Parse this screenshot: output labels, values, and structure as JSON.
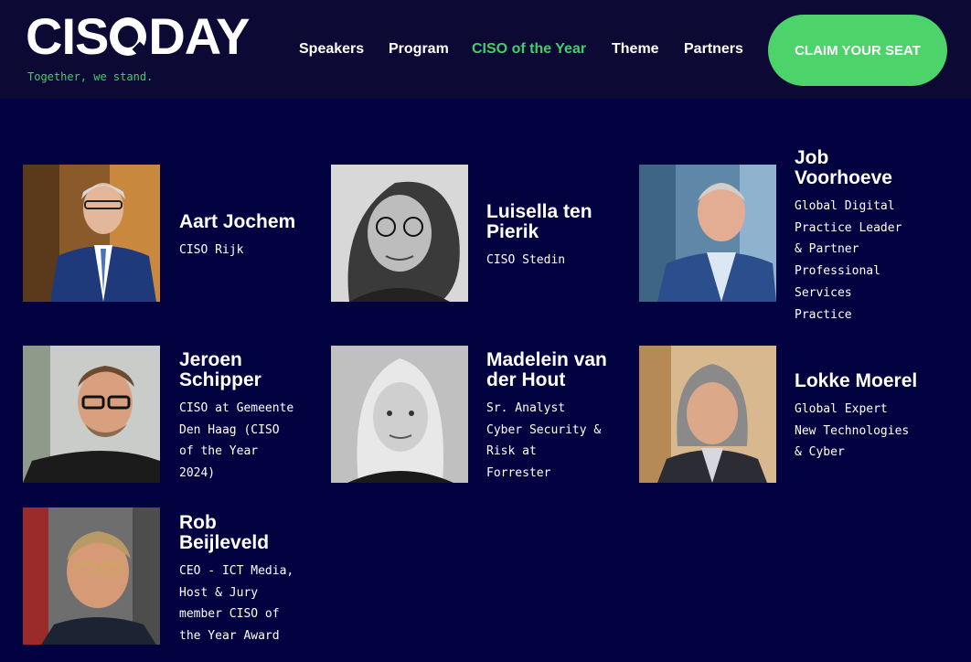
{
  "header": {
    "logo_text_a": "CIS",
    "logo_text_b": "DAY",
    "tagline": "Together, we stand.",
    "nav": [
      {
        "label": "Speakers"
      },
      {
        "label": "Program"
      },
      {
        "label": "CISO of the Year",
        "active": true
      },
      {
        "label": "Theme"
      },
      {
        "label": "Partners"
      }
    ],
    "cta_label": "CLAIM YOUR SEAT"
  },
  "colors": {
    "background": "#020240",
    "header_bg": "#0c0935",
    "accent": "#4cd36a"
  },
  "speakers": [
    {
      "name": "Aart Jochem",
      "role": "CISO Rijk"
    },
    {
      "name": "Luisella ten\nPierik",
      "role": "CISO Stedin"
    },
    {
      "name": "Job\nVoorhoeve",
      "role": "Global Digital\nPractice Leader\n& Partner\nProfessional\nServices\nPractice"
    },
    {
      "name": "Jeroen\nSchipper",
      "role": "CISO at Gemeente\nDen Haag (CISO\nof the Year\n2024)"
    },
    {
      "name": "Madelein van\nder Hout",
      "role": "Sr. Analyst\nCyber Security &\nRisk at\nForrester"
    },
    {
      "name": "Lokke Moerel",
      "role": "Global Expert\nNew Technologies\n& Cyber"
    },
    {
      "name": "Rob\nBeijleveld",
      "role": "CEO - ICT Media,\nHost & Jury\nmember CISO of\nthe Year Award"
    }
  ]
}
